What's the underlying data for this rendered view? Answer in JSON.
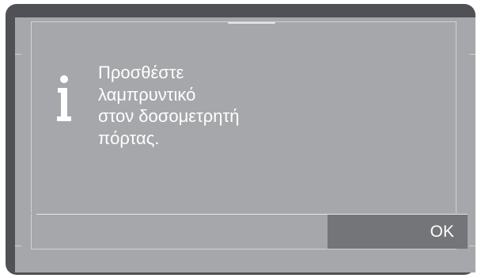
{
  "dialog": {
    "icon": "info-icon",
    "message": "Προσθέστε\nλαμπρυντικό\nστον δοσομετρητή\nπόρτας.",
    "ok_label": "OK"
  },
  "colors": {
    "bezel": "#4f5154",
    "screen_background": "#a5a7aa",
    "button_background": "#737578",
    "text": "#ffffff"
  }
}
